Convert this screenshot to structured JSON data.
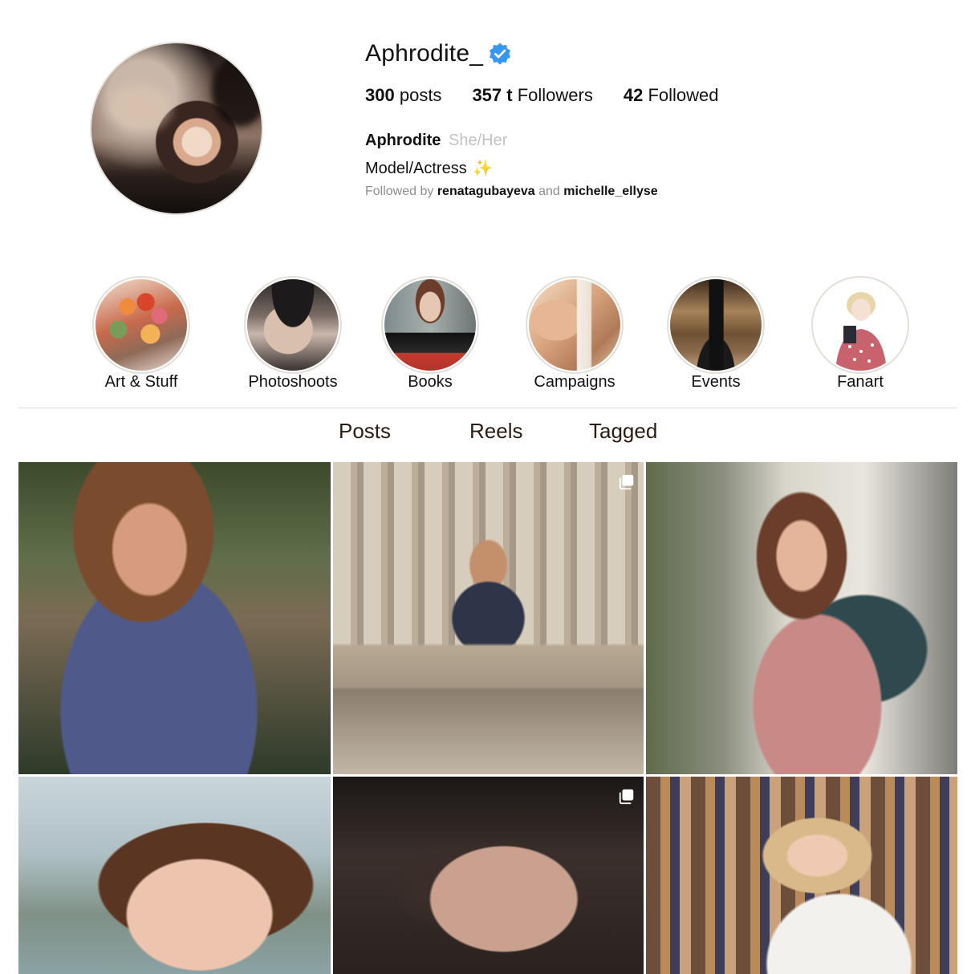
{
  "profile": {
    "username": "Aphrodite_",
    "verified": true,
    "stats": {
      "posts_count": "300",
      "posts_label": "posts",
      "followers_count": "357 t",
      "followers_label": "Followers",
      "followed_count": "42",
      "followed_label": "Followed"
    },
    "bio": {
      "name": "Aphrodite",
      "pronouns": "She/Her",
      "text": "Model/Actress",
      "emoji": "✨",
      "followed_by_prefix": "Followed by",
      "followed_by_user1": "renatagubayeva",
      "followed_by_joiner": "and",
      "followed_by_user2": "michelle_ellyse"
    }
  },
  "highlights": [
    {
      "label": "Art & Stuff"
    },
    {
      "label": "Photoshoots"
    },
    {
      "label": "Books"
    },
    {
      "label": "Campaigns"
    },
    {
      "label": "Events"
    },
    {
      "label": "Fanart"
    }
  ],
  "tabs": [
    {
      "label": "Posts"
    },
    {
      "label": "Reels"
    },
    {
      "label": "Tagged"
    }
  ],
  "posts": [
    {
      "multi": false
    },
    {
      "multi": true
    },
    {
      "multi": false
    },
    {
      "multi": false
    },
    {
      "multi": true
    },
    {
      "multi": false
    }
  ],
  "colors": {
    "verified_badge": "#3897f0",
    "text_primary": "#111111",
    "text_muted": "#8e8e8e",
    "pronouns": "#c3c3c3",
    "divider": "#dbdbdb",
    "ring": "#e3dfd8"
  }
}
